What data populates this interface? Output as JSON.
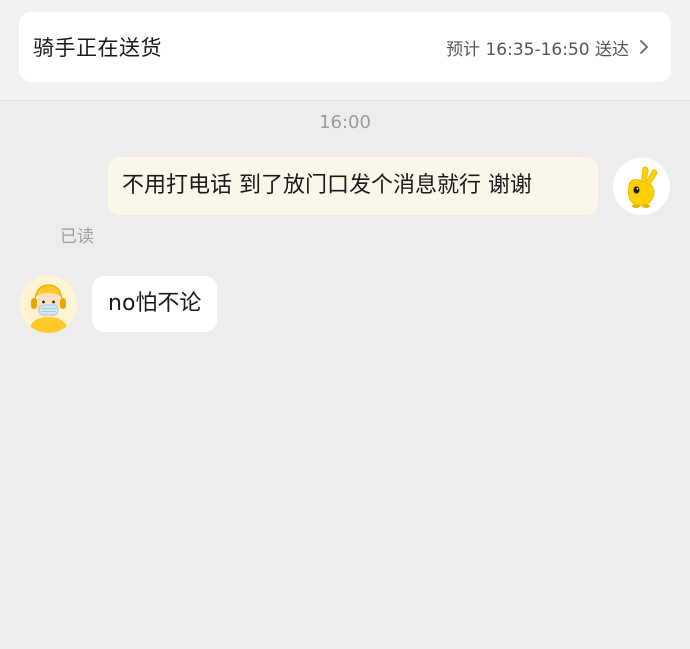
{
  "delivery_status": {
    "title": "骑手正在送货",
    "eta": "预计 16:35-16:50 送达",
    "chevron_icon": "chevron-right-icon"
  },
  "chat": {
    "timestamp": "16:00",
    "messages": [
      {
        "sender": "me",
        "text": "不用打电话 到了放门口发个消息就行 谢谢",
        "read_status": "已读",
        "avatar_icon": "yellow-hand-mascot-icon"
      },
      {
        "sender": "rider",
        "text": "no怕不论",
        "avatar_icon": "rider-avatar-icon"
      }
    ]
  },
  "colors": {
    "background": "#ededed",
    "card": "#ffffff",
    "my_bubble": "#faf6ea",
    "rider_bubble": "#ffffff",
    "muted_text": "#9a9a9a",
    "accent_yellow": "#ffd100"
  }
}
